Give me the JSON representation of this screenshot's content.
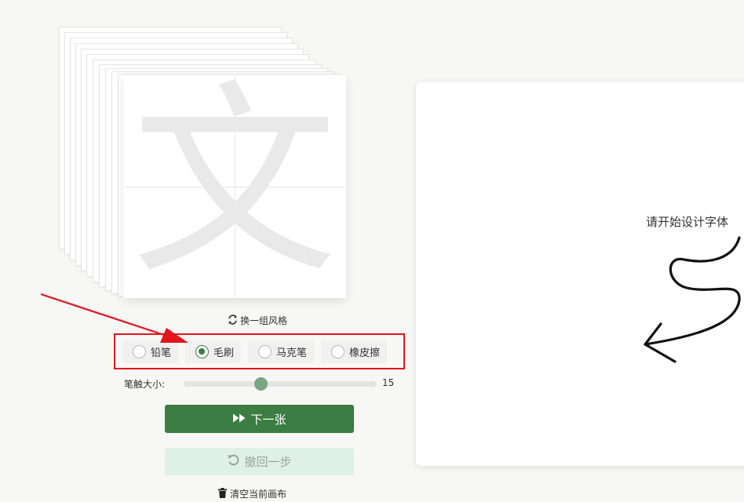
{
  "reference": {
    "character": "文",
    "switch_label": "换一组风格"
  },
  "tools": {
    "options": [
      {
        "label": "铅笔",
        "checked": false
      },
      {
        "label": "毛刷",
        "checked": true
      },
      {
        "label": "马克笔",
        "checked": false
      },
      {
        "label": "橡皮擦",
        "checked": false
      }
    ]
  },
  "brush": {
    "label": "笔触大小:",
    "value": "15",
    "level": 0.4
  },
  "buttons": {
    "next_label": "下一张",
    "undo_label": "撤回一步",
    "clear_label": "清空当前画布"
  },
  "canvas": {
    "hint": "请开始设计字体"
  },
  "colors": {
    "accent": "#3b7d42",
    "annotation": "#e0161b"
  },
  "icons": {
    "switch": "refresh-icon",
    "next": "fast-forward-icon",
    "undo": "undo-icon",
    "clear": "trash-icon"
  }
}
